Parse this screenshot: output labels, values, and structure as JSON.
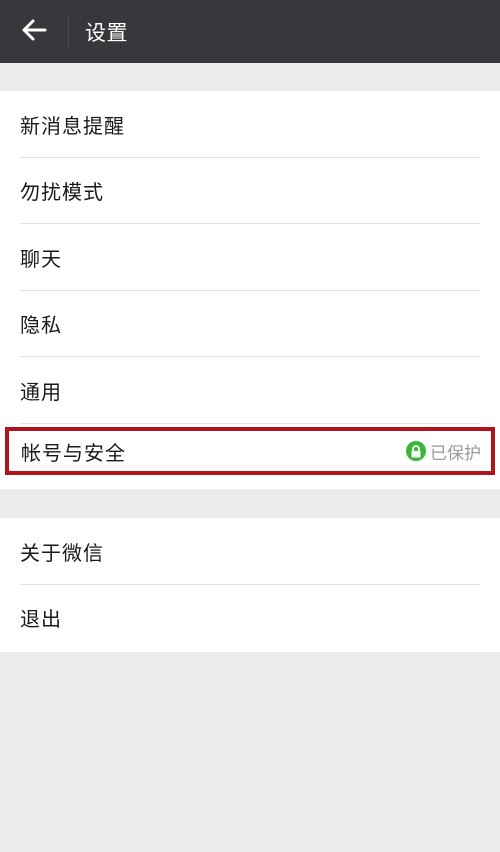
{
  "header": {
    "title": "设置"
  },
  "settings_group_1": {
    "items": [
      {
        "label": "新消息提醒"
      },
      {
        "label": "勿扰模式"
      },
      {
        "label": "聊天"
      },
      {
        "label": "隐私"
      },
      {
        "label": "通用"
      },
      {
        "label": "帐号与安全",
        "status": "已保护"
      }
    ]
  },
  "settings_group_2": {
    "items": [
      {
        "label": "关于微信"
      },
      {
        "label": "退出"
      }
    ]
  },
  "colors": {
    "topbar": "#38383c",
    "background": "#ebebeb",
    "highlight_border": "#b2141b",
    "lock_badge": "#3bb53a"
  },
  "icons": {
    "back": "back-arrow-icon",
    "protected": "lock-icon"
  }
}
